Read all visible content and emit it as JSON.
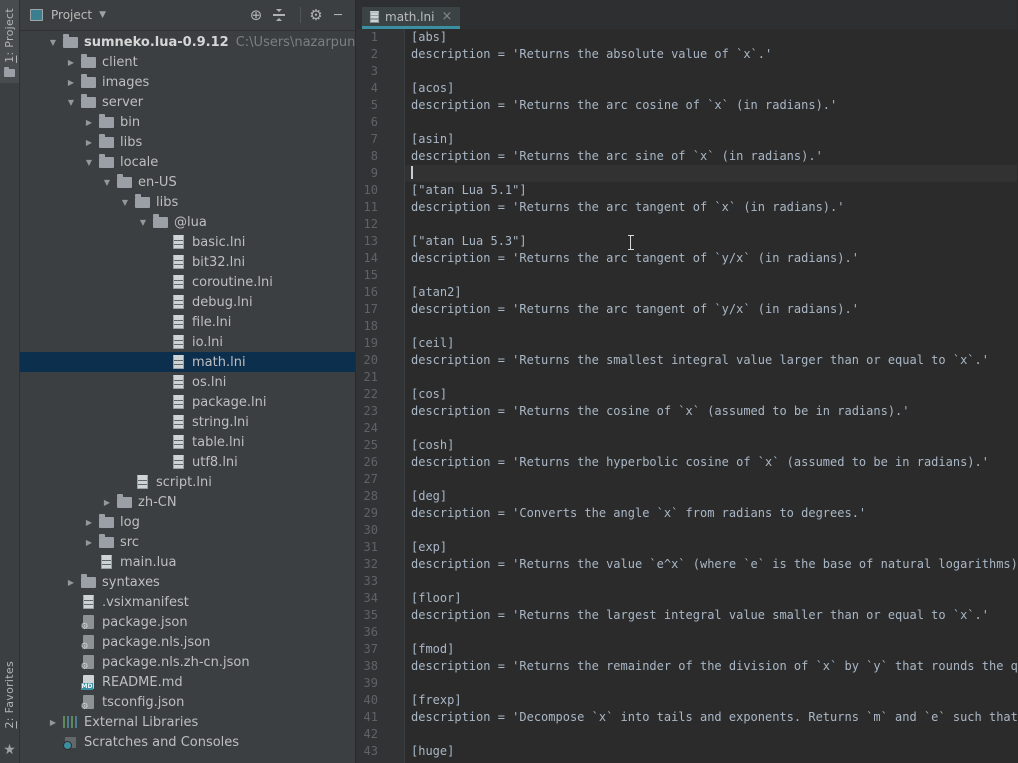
{
  "stripe": {
    "project_button": {
      "mnemonic": "1",
      "rest": ": Project"
    },
    "favorites_button": {
      "mnemonic": "2",
      "rest": ": Favorites"
    }
  },
  "icons": {
    "locate": "⊕",
    "gear": "⚙",
    "minimize": "─",
    "chevron_down": "▼",
    "star": "★",
    "close": "×",
    "arrow_expanded": "▼",
    "arrow_collapsed": "▶"
  },
  "project_panel": {
    "title": "Project",
    "tree": [
      {
        "label": "sumneko.lua-0.9.12",
        "level": 0,
        "arrow": "expanded",
        "icon": "folder",
        "bold": true,
        "suffix": "C:\\Users\\nazarpunk\\.vscode\\exter"
      },
      {
        "label": "client",
        "level": 1,
        "arrow": "collapsed",
        "icon": "folder"
      },
      {
        "label": "images",
        "level": 1,
        "arrow": "collapsed",
        "icon": "folder"
      },
      {
        "label": "server",
        "level": 1,
        "arrow": "expanded",
        "icon": "folder"
      },
      {
        "label": "bin",
        "level": 2,
        "arrow": "collapsed",
        "icon": "folder"
      },
      {
        "label": "libs",
        "level": 2,
        "arrow": "collapsed",
        "icon": "folder"
      },
      {
        "label": "locale",
        "level": 2,
        "arrow": "expanded",
        "icon": "folder"
      },
      {
        "label": "en-US",
        "level": 3,
        "arrow": "expanded",
        "icon": "folder"
      },
      {
        "label": "libs",
        "level": 4,
        "arrow": "expanded",
        "icon": "folder"
      },
      {
        "label": "@lua",
        "level": 5,
        "arrow": "expanded",
        "icon": "folder"
      },
      {
        "label": "basic.lni",
        "level": 6,
        "icon": "file"
      },
      {
        "label": "bit32.lni",
        "level": 6,
        "icon": "file"
      },
      {
        "label": "coroutine.lni",
        "level": 6,
        "icon": "file"
      },
      {
        "label": "debug.lni",
        "level": 6,
        "icon": "file"
      },
      {
        "label": "file.lni",
        "level": 6,
        "icon": "file"
      },
      {
        "label": "io.lni",
        "level": 6,
        "icon": "file"
      },
      {
        "label": "math.lni",
        "level": 6,
        "icon": "file",
        "selected": true
      },
      {
        "label": "os.lni",
        "level": 6,
        "icon": "file"
      },
      {
        "label": "package.lni",
        "level": 6,
        "icon": "file"
      },
      {
        "label": "string.lni",
        "level": 6,
        "icon": "file"
      },
      {
        "label": "table.lni",
        "level": 6,
        "icon": "file"
      },
      {
        "label": "utf8.lni",
        "level": 6,
        "icon": "file"
      },
      {
        "label": "script.lni",
        "level": 4,
        "icon": "file"
      },
      {
        "label": "zh-CN",
        "level": 3,
        "arrow": "collapsed",
        "icon": "folder"
      },
      {
        "label": "log",
        "level": 2,
        "arrow": "collapsed",
        "icon": "folder"
      },
      {
        "label": "src",
        "level": 2,
        "arrow": "collapsed",
        "icon": "folder"
      },
      {
        "label": "main.lua",
        "level": 2,
        "icon": "file"
      },
      {
        "label": "syntaxes",
        "level": 1,
        "arrow": "collapsed",
        "icon": "folder"
      },
      {
        "label": ".vsixmanifest",
        "level": 1,
        "icon": "file"
      },
      {
        "label": "package.json",
        "level": 1,
        "icon": "json"
      },
      {
        "label": "package.nls.json",
        "level": 1,
        "icon": "json"
      },
      {
        "label": "package.nls.zh-cn.json",
        "level": 1,
        "icon": "json"
      },
      {
        "label": "README.md",
        "level": 1,
        "icon": "md"
      },
      {
        "label": "tsconfig.json",
        "level": 1,
        "icon": "json"
      },
      {
        "label": "External Libraries",
        "level": 0,
        "arrow": "collapsed",
        "icon": "lib"
      },
      {
        "label": "Scratches and Consoles",
        "level": 0,
        "icon": "scratch"
      }
    ]
  },
  "editor": {
    "tab": {
      "label": "math.lni"
    },
    "caret_line": 9,
    "lines": [
      "[abs]",
      "description = 'Returns the absolute value of `x`.'",
      "",
      "[acos]",
      "description = 'Returns the arc cosine of `x` (in radians).'",
      "",
      "[asin]",
      "description = 'Returns the arc sine of `x` (in radians).'",
      "",
      "[\"atan Lua 5.1\"]",
      "description = 'Returns the arc tangent of `x` (in radians).'",
      "",
      "[\"atan Lua 5.3\"]",
      "description = 'Returns the arc tangent of `y/x` (in radians).'",
      "",
      "[atan2]",
      "description = 'Returns the arc tangent of `y/x` (in radians).'",
      "",
      "[ceil]",
      "description = 'Returns the smallest integral value larger than or equal to `x`.'",
      "",
      "[cos]",
      "description = 'Returns the cosine of `x` (assumed to be in radians).'",
      "",
      "[cosh]",
      "description = 'Returns the hyperbolic cosine of `x` (assumed to be in radians).'",
      "",
      "[deg]",
      "description = 'Converts the angle `x` from radians to degrees.'",
      "",
      "[exp]",
      "description = 'Returns the value `e^x` (where `e` is the base of natural logarithms).",
      "",
      "[floor]",
      "description = 'Returns the largest integral value smaller than or equal to `x`.'",
      "",
      "[fmod]",
      "description = 'Returns the remainder of the division of `x` by `y` that rounds the qu",
      "",
      "[frexp]",
      "description = 'Decompose `x` into tails and exponents. Returns `m` and `e` such that ",
      "",
      "[huge]"
    ]
  },
  "colors": {
    "panel_bg": "#3c3f41",
    "editor_bg": "#2b2b2b",
    "gutter_bg": "#313335",
    "selection_bg": "#0d2f4e",
    "caret_row_bg": "#323232",
    "tab_accent": "#3a8fa0",
    "editor_text": "#a9b7c6"
  }
}
